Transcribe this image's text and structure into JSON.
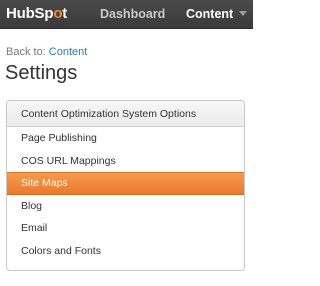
{
  "topbar": {
    "logo": {
      "text_before": "HubSp",
      "text_spot": "o",
      "text_after": "t",
      "spot_color": "#f48930"
    },
    "nav": {
      "dashboard_label": "Dashboard",
      "content_label": "Content",
      "content_icon": "chevron-down-icon"
    }
  },
  "breadcrumb": {
    "prefix": "Back to: ",
    "link_label": "Content"
  },
  "page": {
    "title": "Settings"
  },
  "panel": {
    "header": "Content Optimization System Options",
    "items": [
      {
        "label": "Page Publishing",
        "active": false
      },
      {
        "label": "COS URL Mappings",
        "active": false
      },
      {
        "label": "Site Maps",
        "active": true
      },
      {
        "label": "Blog",
        "active": false
      },
      {
        "label": "Email",
        "active": false
      },
      {
        "label": "Colors and Fonts",
        "active": false
      }
    ],
    "active_color": "#f08a3c"
  }
}
